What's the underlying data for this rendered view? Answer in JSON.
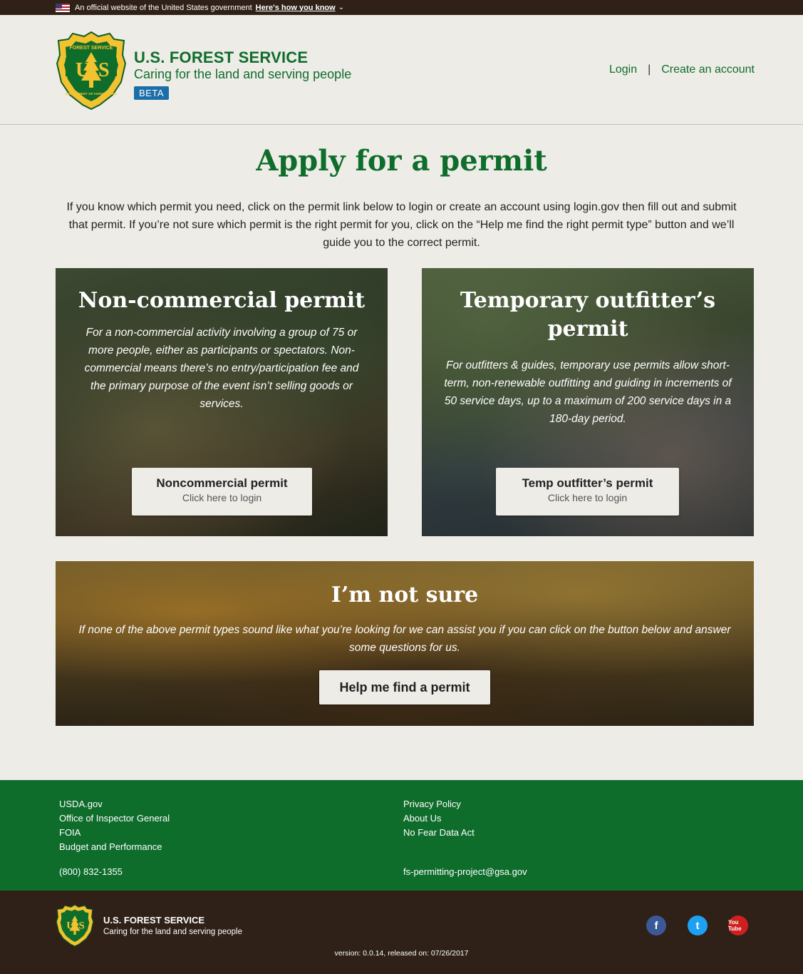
{
  "gov_banner": {
    "text": "An official website of the United States government",
    "link": "Here's how you know"
  },
  "header": {
    "title": "U.S. FOREST SERVICE",
    "tagline": "Caring for the land and serving people",
    "badge": "BETA",
    "logo_text_top": "FOREST SERVICE",
    "logo_text_bottom": "DEPARTMENT OF AGRICULTURE",
    "login": "Login",
    "separator": "|",
    "create_account": "Create an account"
  },
  "main": {
    "title": "Apply for a permit",
    "intro": "If you know which permit you need, click on the permit link below to login or create an account using login.gov then fill out and submit that permit. If you’re not sure which permit is the right permit for you, click on the “Help me find the right permit type” button and we’ll guide you to the correct permit."
  },
  "cards": {
    "noncommercial": {
      "heading": "Non-commercial permit",
      "description": "For a non-commercial activity involving a group of 75 or more people, either as participants or spectators. Non-commercial means there’s no entry/participation fee and the primary purpose of the event isn’t selling goods or services.",
      "button_label": "Noncommercial permit",
      "button_sub": "Click here to login"
    },
    "outfitter": {
      "heading": "Temporary outfitter’s permit",
      "description": "For outfitters & guides, temporary use permits allow short-term, non-renewable outfitting and guiding in increments of 50 service days, up to a maximum of 200 service days in a 180-day period.",
      "button_label": "Temp outfitter’s permit",
      "button_sub": "Click here to login"
    },
    "not_sure": {
      "heading": "I’m not sure",
      "description": "If none of the above permit types sound like what you’re looking for we can assist you if you can click on the button below and answer some questions for us.",
      "button_label": "Help me find a permit"
    }
  },
  "footer": {
    "left_links": [
      "USDA.gov",
      "Office of Inspector General",
      "FOIA",
      "Budget and Performance"
    ],
    "right_links": [
      "Privacy Policy",
      "About Us",
      "No Fear Data Act"
    ],
    "phone": "(800) 832-1355",
    "email": "fs-permitting-project@gsa.gov",
    "bottom_title": "U.S. FOREST SERVICE",
    "bottom_tagline": "Caring for the land and serving people",
    "version": "version: 0.0.14, released on: 07/26/2017",
    "social": {
      "facebook": "f",
      "twitter": "t",
      "youtube": "You Tube"
    }
  },
  "colors": {
    "brand_green": "#0f6d2c",
    "beta_blue": "#1c6ea8",
    "dark_brown": "#2f2117",
    "background": "#eeece7",
    "shield_gold": "#f2c230"
  },
  "icons": [
    "us-flag-icon",
    "chevron-down-icon",
    "forest-service-shield-icon",
    "facebook-icon",
    "twitter-icon",
    "youtube-icon"
  ]
}
